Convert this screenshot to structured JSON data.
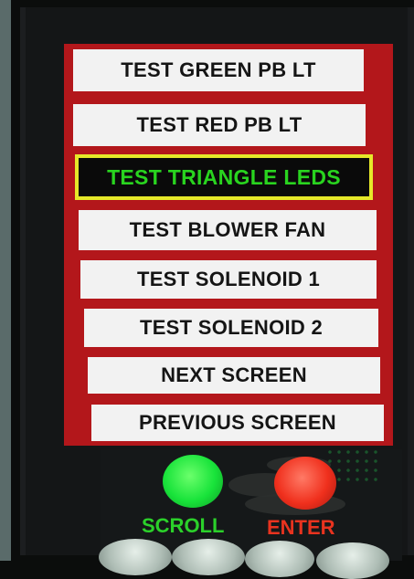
{
  "menu": {
    "items": [
      {
        "label": "TEST GREEN PB LT",
        "selected": false
      },
      {
        "label": "TEST RED PB LT",
        "selected": false
      },
      {
        "label": "TEST TRIANGLE LEDS",
        "selected": true
      },
      {
        "label": "TEST BLOWER FAN",
        "selected": false
      },
      {
        "label": "TEST SOLENOID 1",
        "selected": false
      },
      {
        "label": "TEST SOLENOID 2",
        "selected": false
      },
      {
        "label": "NEXT SCREEN",
        "selected": false
      },
      {
        "label": "PREVIOUS SCREEN",
        "selected": false
      }
    ]
  },
  "buttons": {
    "scroll": {
      "label": "SCROLL",
      "lamp_color": "#18e33a"
    },
    "enter": {
      "label": "ENTER",
      "lamp_color": "#f0301d"
    }
  },
  "colors": {
    "menu_border": "#b3171b",
    "item_background": "#f2f2f2",
    "selected_background": "#0a0a0a",
    "selected_text": "#29d41f",
    "selected_outline": "#e6e829",
    "scroll_label": "#2bd12a",
    "enter_label": "#e8331f"
  }
}
